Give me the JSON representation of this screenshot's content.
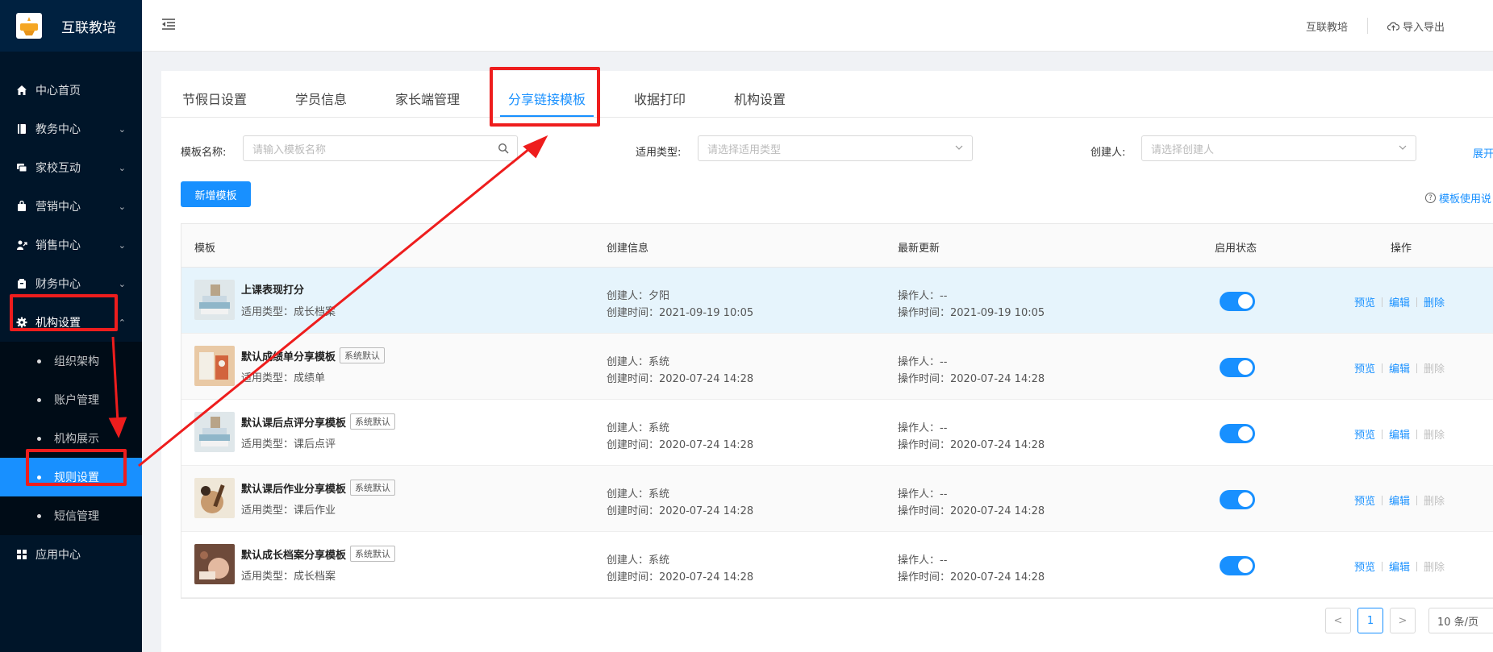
{
  "app": {
    "name": "互联教培",
    "logo_text": "互联教培"
  },
  "sidebar": {
    "items": [
      {
        "label": "中心首页",
        "icon": "home-icon"
      },
      {
        "label": "教务中心",
        "icon": "book-icon"
      },
      {
        "label": "家校互动",
        "icon": "chat-icon"
      },
      {
        "label": "营销中心",
        "icon": "bag-icon"
      },
      {
        "label": "销售中心",
        "icon": "chart-icon"
      },
      {
        "label": "财务中心",
        "icon": "wallet-icon"
      },
      {
        "label": "机构设置",
        "icon": "gear-icon"
      }
    ],
    "sub_items": [
      {
        "label": "组织架构"
      },
      {
        "label": "账户管理"
      },
      {
        "label": "机构展示"
      },
      {
        "label": "规则设置"
      },
      {
        "label": "短信管理"
      }
    ],
    "app_center": {
      "label": "应用中心",
      "icon": "grid-icon"
    }
  },
  "header": {
    "org_name": "互联教培",
    "import_export": "导入导出"
  },
  "tabs": [
    "节假日设置",
    "学员信息",
    "家长端管理",
    "分享链接模板",
    "收据打印",
    "机构设置"
  ],
  "active_tab": "分享链接模板",
  "filters": {
    "name_label": "模板名称:",
    "name_placeholder": "请输入模板名称",
    "type_label": "适用类型:",
    "type_placeholder": "请选择适用类型",
    "creator_label": "创建人:",
    "creator_placeholder": "请选择创建人",
    "expand": "展开"
  },
  "actions": {
    "add": "新增模板",
    "help": "模板使用说"
  },
  "table": {
    "headers": [
      "模板",
      "创建信息",
      "最新更新",
      "启用状态",
      "操作"
    ],
    "rows": [
      {
        "name": "上课表现打分",
        "badge": "",
        "type": "适用类型：成长档案",
        "creator": "创建人：夕阳",
        "created": "创建时间：2021-09-19 10:05",
        "operator": "操作人：--",
        "updated": "操作时间：2021-09-19 10:05",
        "enabled": true,
        "delete_enabled": true
      },
      {
        "name": "默认成绩单分享模板",
        "badge": "系统默认",
        "type": "适用类型：成绩单",
        "creator": "创建人：系统",
        "created": "创建时间：2020-07-24 14:28",
        "operator": "操作人：--",
        "updated": "操作时间：2020-07-24 14:28",
        "enabled": true,
        "delete_enabled": false
      },
      {
        "name": "默认课后点评分享模板",
        "badge": "系统默认",
        "type": "适用类型：课后点评",
        "creator": "创建人：系统",
        "created": "创建时间：2020-07-24 14:28",
        "operator": "操作人：--",
        "updated": "操作时间：2020-07-24 14:28",
        "enabled": true,
        "delete_enabled": false
      },
      {
        "name": "默认课后作业分享模板",
        "badge": "系统默认",
        "type": "适用类型：课后作业",
        "creator": "创建人：系统",
        "created": "创建时间：2020-07-24 14:28",
        "operator": "操作人：--",
        "updated": "操作时间：2020-07-24 14:28",
        "enabled": true,
        "delete_enabled": false
      },
      {
        "name": "默认成长档案分享模板",
        "badge": "系统默认",
        "type": "适用类型：成长档案",
        "creator": "创建人：系统",
        "created": "创建时间：2020-07-24 14:28",
        "operator": "操作人：--",
        "updated": "操作时间：2020-07-24 14:28",
        "enabled": true,
        "delete_enabled": false
      }
    ],
    "ops": {
      "preview": "预览",
      "edit": "编辑",
      "delete": "删除"
    }
  },
  "pagination": {
    "prev": "<",
    "page": "1",
    "next": ">",
    "page_size": "10 条/页"
  },
  "colors": {
    "primary": "#1890ff",
    "sidebar_bg": "#001529",
    "annotation": "#ee1d1d"
  }
}
